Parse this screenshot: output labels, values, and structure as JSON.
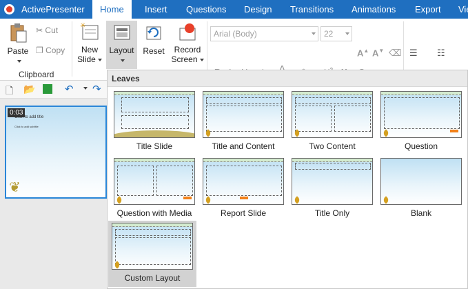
{
  "app": {
    "name": "ActivePresenter"
  },
  "tabs": [
    "Home",
    "Insert",
    "Questions",
    "Design",
    "Transitions",
    "Animations",
    "Export",
    "Vie"
  ],
  "ribbon": {
    "clipboard": {
      "paste": "Paste",
      "cut": "Cut",
      "copy": "Copy",
      "label": "Clipboard"
    },
    "slides": {
      "new_slide_line1": "New",
      "new_slide_line2": "Slide",
      "layout": "Layout",
      "reset": "Reset",
      "record_line1": "Record",
      "record_line2": "Screen"
    },
    "font": {
      "family": "Arial (Body)",
      "size": "22"
    }
  },
  "slide_thumb": {
    "time": "0:03",
    "title": "Click to add title",
    "subtitle": "Click to add subtitle"
  },
  "layout_menu": {
    "header": "Leaves",
    "items": [
      "Title Slide",
      "Title and Content",
      "Two Content",
      "Question",
      "Question with Media",
      "Report Slide",
      "Title Only",
      "Blank",
      "Custom Layout"
    ]
  }
}
